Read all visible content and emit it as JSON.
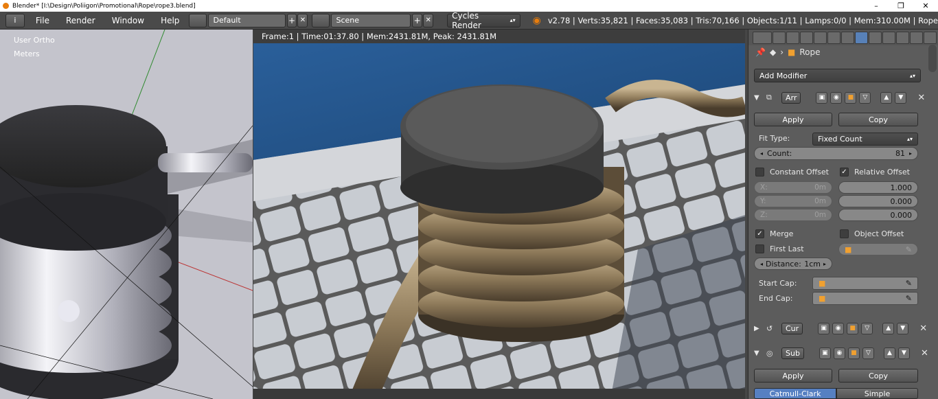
{
  "window": {
    "title": "Blender* [I:\\Design\\Poliigon\\Promotional\\Rope\\rope3.blend]",
    "min": "–",
    "max": "❐",
    "close": "✕"
  },
  "menubar": {
    "info_icon": "i",
    "file": "File",
    "render": "Render",
    "window": "Window",
    "help": "Help",
    "layout": "Default",
    "scene": "Scene",
    "engine": "Cycles Render",
    "stats": "v2.78 | Verts:35,821 | Faces:35,083 | Tris:70,166 | Objects:1/11 | Lamps:0/0 | Mem:310.00M | Rope"
  },
  "left_viewport": {
    "view": "User Ortho",
    "units": "Meters"
  },
  "render_view": {
    "info": "Frame:1 | Time:01:37.80 | Mem:2431.81M, Peak: 2431.81M"
  },
  "props": {
    "object_name": "Rope",
    "add_modifier": "Add Modifier",
    "array": {
      "name": "Arr",
      "apply": "Apply",
      "copy": "Copy",
      "fit_type_label": "Fit Type:",
      "fit_type": "Fixed Count",
      "count_label": "Count:",
      "count": "81",
      "constant_offset": "Constant Offset",
      "relative_offset": "Relative Offset",
      "x_label": "X:",
      "y_label": "Y:",
      "z_label": "Z:",
      "x": "0m",
      "y": "0m",
      "z": "0m",
      "rx": "1.000",
      "ry": "0.000",
      "rz": "0.000",
      "merge": "Merge",
      "object_offset": "Object Offset",
      "first_last": "First Last",
      "distance_label": "Distance:",
      "distance": "1cm",
      "start_cap": "Start Cap:",
      "end_cap": "End Cap:"
    },
    "curve": {
      "name": "Cur"
    },
    "subsurf": {
      "name": "Sub",
      "apply": "Apply",
      "copy": "Copy",
      "catmull": "Catmull-Clark",
      "simple": "Simple"
    }
  }
}
